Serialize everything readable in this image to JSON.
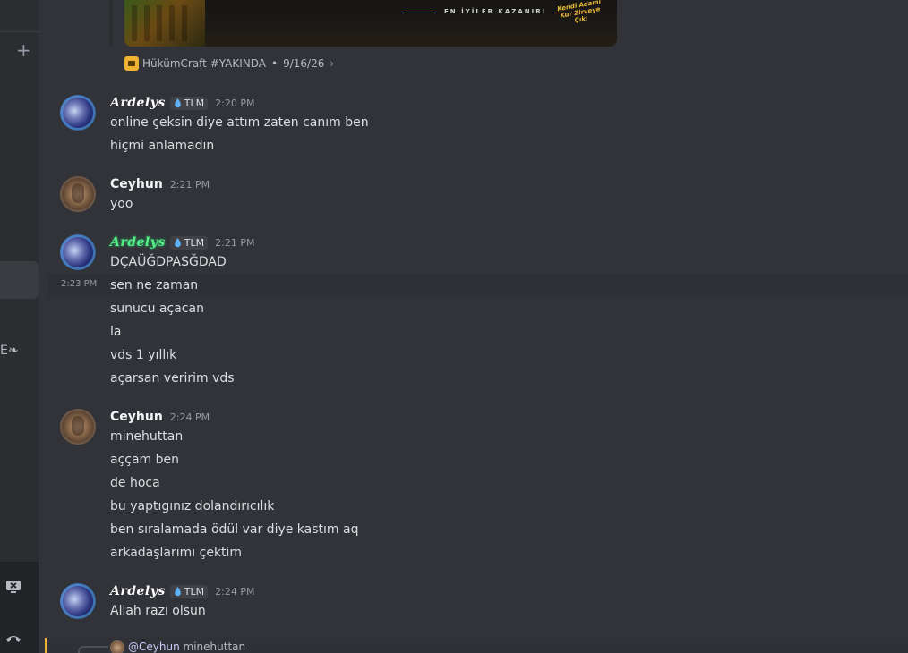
{
  "embed": {
    "banner_tagline": "EN İYİLER KAZANIR!",
    "banner_stamp": "Kendi Adamı Kur Zirveye Çık!",
    "footer_source": "HükümCraft #YAKINDA",
    "footer_separator": "•",
    "footer_date": "9/16/26",
    "footer_chevron": "›"
  },
  "sidebar": {
    "plus_glyph": "+",
    "partial_label": "E❧"
  },
  "colors": {
    "background": "#313338",
    "sidebar": "#2b2d31",
    "text": "#dbdee1",
    "timestamp": "#949ba4",
    "reply_accent": "#f0b232",
    "mention": "#c9cdfb"
  },
  "groups": [
    {
      "user": "Ardelys",
      "tag": "TLM",
      "time": "2:20 PM",
      "lines": [
        "online çeksin diye attım zaten canım ben",
        "hiçmi anlamadın"
      ]
    },
    {
      "user": "Ceyhun",
      "time": "2:21 PM",
      "lines": [
        "yoo"
      ]
    },
    {
      "user": "Ardelys",
      "tag": "TLM",
      "time": "2:21 PM",
      "lines": [
        "DÇAÜĞDPASĞDAD",
        "sen ne zaman",
        "sunucu açacan",
        "la",
        "vds 1 yıllık",
        "açarsan veririm vds"
      ],
      "hover_time": "2:23 PM"
    },
    {
      "user": "Ceyhun",
      "time": "2:24 PM",
      "lines": [
        "minehuttan",
        "aççam ben",
        "de hoca",
        "bu yaptıgınız dolandırıcılık",
        "ben sıralamada ödül var diye kastım aq",
        "arkadaşlarımı çektim"
      ]
    },
    {
      "user": "Ardelys",
      "tag": "TLM",
      "time": "2:24 PM",
      "lines": [
        "Allah razı olsun"
      ]
    }
  ],
  "reply": {
    "mention": "@Ceyhun",
    "text": "minehuttan"
  }
}
